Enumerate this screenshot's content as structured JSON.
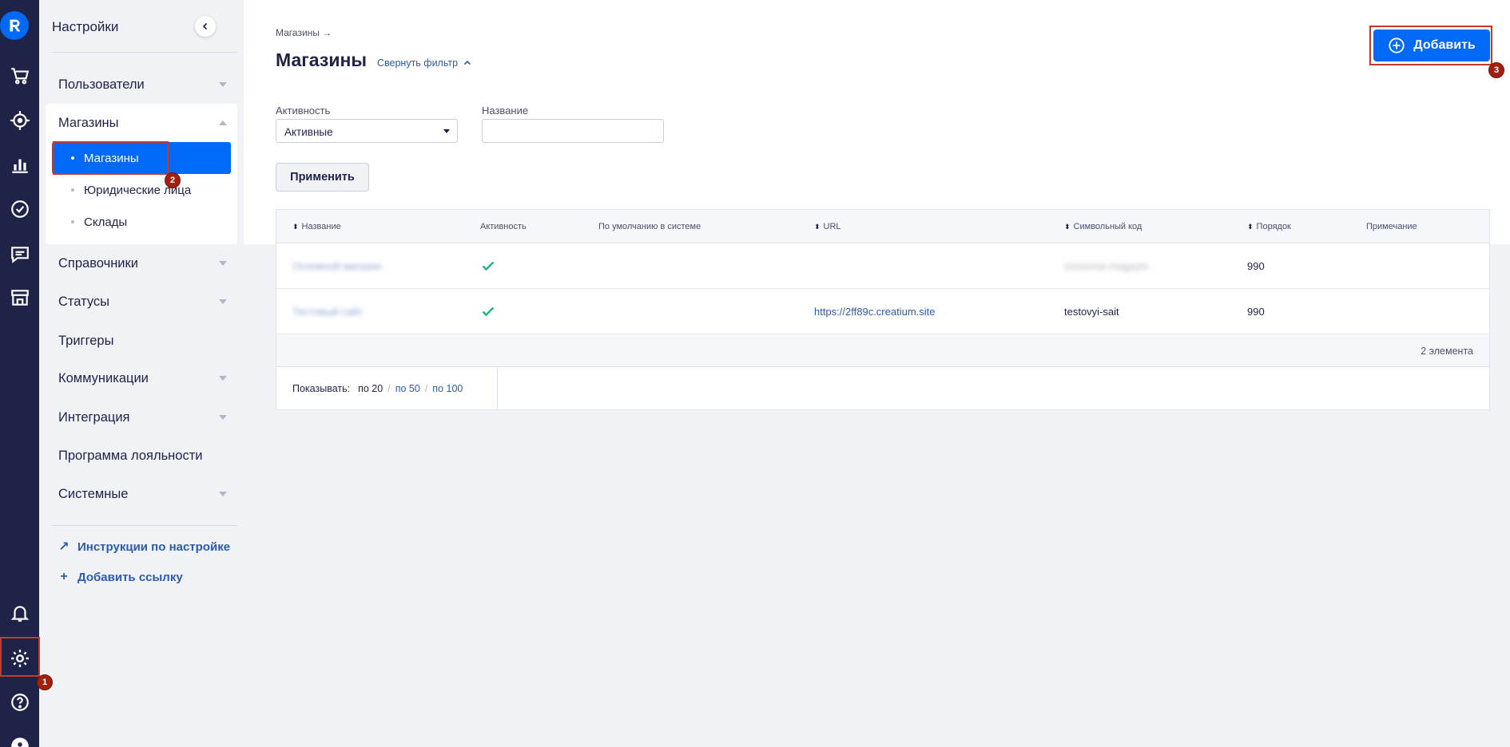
{
  "sidebar": {
    "title": "Настройки",
    "items": [
      {
        "label": "Пользователи",
        "has_caret": true
      },
      {
        "label": "Магазины",
        "expanded": true
      },
      {
        "label": "Справочники",
        "has_caret": true
      },
      {
        "label": "Статусы",
        "has_caret": true
      },
      {
        "label": "Триггеры",
        "has_caret": false
      },
      {
        "label": "Коммуникации",
        "has_caret": true
      },
      {
        "label": "Интеграция",
        "has_caret": true
      },
      {
        "label": "Программа лояльности",
        "has_caret": false
      },
      {
        "label": "Системные",
        "has_caret": true
      }
    ],
    "sub_items": [
      {
        "label": "Магазины",
        "active": true
      },
      {
        "label": "Юридические лица",
        "active": false
      },
      {
        "label": "Склады",
        "active": false
      }
    ],
    "links": [
      {
        "icon": "arrow-up-right-icon",
        "label": "Инструкции по настройке"
      },
      {
        "icon": "plus-icon",
        "label": "Добавить ссылку"
      }
    ]
  },
  "rail": {
    "icons": [
      "logo-icon",
      "cart-icon",
      "target-icon",
      "bar-chart-icon",
      "check-circle-icon",
      "chat-icon",
      "store-icon",
      "bell-icon",
      "gear-icon",
      "help-icon",
      "avatar-icon"
    ]
  },
  "main": {
    "breadcrumb": "Магазины →",
    "title": "Магазины",
    "collapse_filter": "Свернуть фильтр",
    "add_button": "Добавить",
    "filters": {
      "activity_label": "Активность",
      "activity_value": "Активные",
      "name_label": "Название",
      "name_value": ""
    },
    "apply_button": "Применить"
  },
  "table": {
    "columns": [
      "Название",
      "Активность",
      "По умолчанию в системе",
      "URL",
      "Символьный код",
      "Порядок",
      "Примечание"
    ],
    "rows": [
      {
        "name": "Основной магазин",
        "active": true,
        "default": "",
        "url": "",
        "code": "osnovnoi-magazin",
        "order": "990",
        "note": ""
      },
      {
        "name": "Тестовый сайт",
        "active": true,
        "default": "",
        "url": "https://2ff89c.creatium.site",
        "code": "testovyi-sait",
        "order": "990",
        "note": ""
      }
    ],
    "count": "2 элемента",
    "pager": {
      "label": "Показывать:",
      "options": [
        "по 20",
        "по 50",
        "по 100"
      ]
    }
  },
  "annotations": [
    "1",
    "2",
    "3"
  ],
  "colors": {
    "accent": "#0169f7",
    "rail": "#1f2347",
    "highlight": "#c33a2b",
    "check": "#1fb57a"
  }
}
